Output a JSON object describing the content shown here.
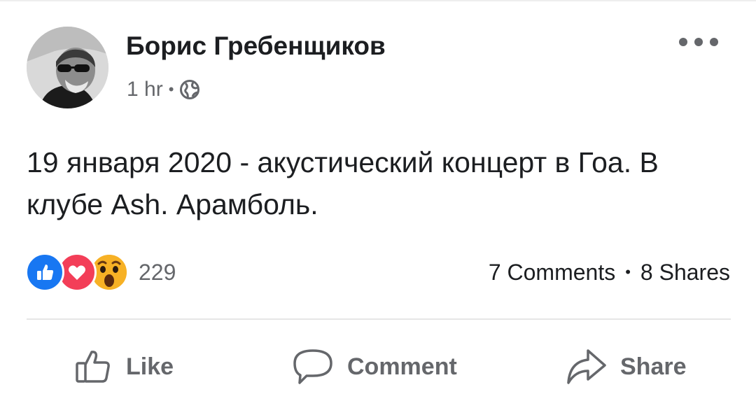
{
  "post": {
    "author": "Борис Гребенщиков",
    "time": "1 hr",
    "meta_separator": "•",
    "audience_icon": "globe-icon",
    "text": "19 января 2020 - акустический концерт в Гоа. В клубе Ash. Арамболь."
  },
  "menu": {
    "icon": "more-options-icon"
  },
  "reactions": {
    "types": [
      "like",
      "love",
      "wow"
    ],
    "count": "229"
  },
  "engagement": {
    "comments": "7 Comments",
    "separator": "•",
    "shares": "8 Shares"
  },
  "actions": {
    "like_label": "Like",
    "comment_label": "Comment",
    "share_label": "Share"
  },
  "colors": {
    "text": "#1c1e21",
    "secondary": "#65676b",
    "like_blue": "#1877f2",
    "love_red": "#f33e58",
    "wow_yellow": "#f7b125"
  }
}
